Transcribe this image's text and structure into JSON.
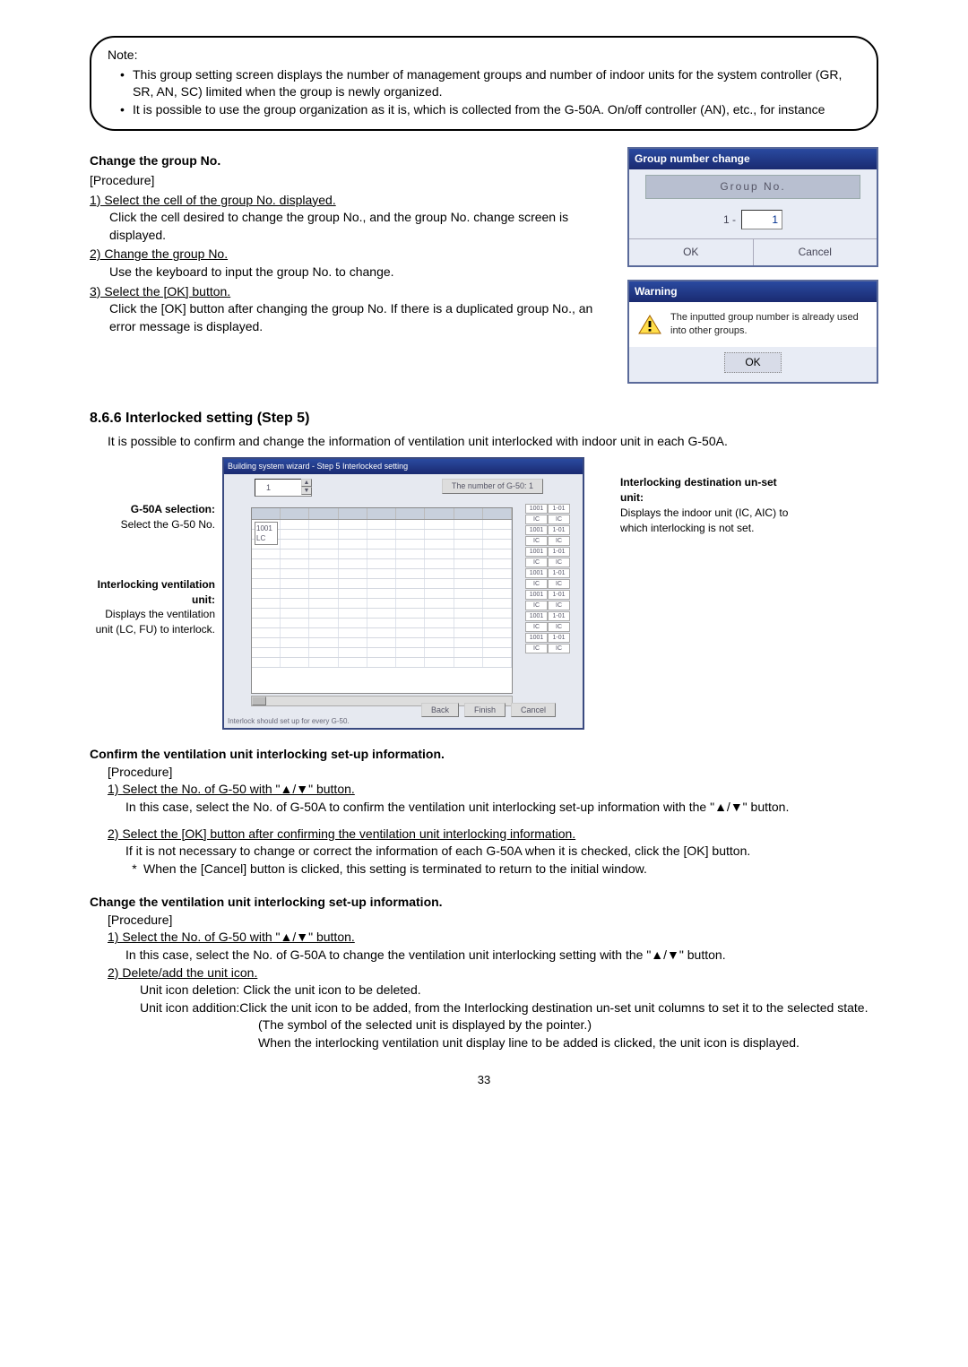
{
  "note": {
    "title": "Note:",
    "items": [
      "This group setting screen displays the number of management groups and number of indoor units for the system controller (GR, SR, AN, SC) limited when the group is newly organized.",
      "It is possible to use the group organization as it is, which is collected from the G-50A. On/off controller (AN), etc., for instance"
    ]
  },
  "changeGroup": {
    "heading": "Change the group No.",
    "procedure": "[Procedure]",
    "step1Lead": "1) Select the cell of the group No. displayed.",
    "step1Body": "Click the cell desired to change the group No., and the group No. change screen is displayed.",
    "step2Lead": "2) Change the group No.",
    "step2Body": "Use the keyboard to input the group No. to change.",
    "step3Lead": "3) Select the [OK] button.",
    "step3Body": "Click the [OK] button after changing the group No. If there is a duplicated group No., an error message is displayed."
  },
  "groupDialog": {
    "title": "Group number change",
    "label": "Group No.",
    "prefix": "1 -",
    "value": "1",
    "ok": "OK",
    "cancel": "Cancel"
  },
  "warnDialog": {
    "title": "Warning",
    "message": "The inputted group number is already used into other groups.",
    "ok": "OK"
  },
  "section": {
    "title": "8.6.6  Interlocked setting (Step 5)",
    "body": "It is possible to confirm and change the information of ventilation unit interlocked with indoor unit in each G-50A."
  },
  "figLabels": {
    "g50Title": "G-50A selection:",
    "g50Body": "Select the G-50 No.",
    "ventTitle": "Interlocking ventilation unit:",
    "ventBody": "Displays the ventilation unit (LC, FU) to interlock.",
    "destTitle": "Interlocking destination un-set unit:",
    "destBody": "Displays the indoor unit (IC, AIC) to which interlocking is not set."
  },
  "figWindow": {
    "titlebar": "Building system wizard - Step 5 Interlocked setting",
    "spinValue": "1",
    "regLabel": "The number of G-50:",
    "regValue": "1",
    "lc": "1001\nLC",
    "sideIC": "IC",
    "btnBack": "Back",
    "btnFinish": "Finish",
    "btnCancel": "Cancel",
    "footer": "Interlock should set up for every G-50."
  },
  "confirm": {
    "heading": "Confirm the ventilation unit interlocking set-up information.",
    "procedure": "[Procedure]",
    "step1Lead": "1) Select the No. of G-50 with \"▲/▼\" button.",
    "step1Body": "In this case, select the No. of G-50A to confirm the ventilation unit interlocking set-up information with the \"▲/▼\" button.",
    "step2Lead": "2) Select the [OK] button after confirming the ventilation unit interlocking information.",
    "step2Body": "If it is not necessary to change or correct the information of each G-50A when it is checked, click the [OK] button.",
    "step2Star": "When the [Cancel] button is clicked, this setting is terminated to return to the initial window."
  },
  "change": {
    "heading": "Change the ventilation unit interlocking set-up information.",
    "procedure": "[Procedure]",
    "step1Lead": "1) Select the No. of G-50 with \"▲/▼\" button.",
    "step1Body": "In this case, select the No. of G-50A to change the ventilation unit interlocking setting with the \"▲/▼\" button.",
    "step2Lead": "2) Delete/add the unit icon.",
    "del": "Unit icon deletion: Click the unit icon to be deleted.",
    "addLead": "Unit icon addition: ",
    "addBody1": "Click the unit icon to be added, from the  Interlocking destination un-set unit columns to set it to the selected state.",
    "addBody2": "(The symbol of the selected unit is displayed by the pointer.)",
    "addBody3": "When the interlocking ventilation unit display line to be added is clicked, the unit icon is displayed."
  },
  "pageNumber": "33"
}
